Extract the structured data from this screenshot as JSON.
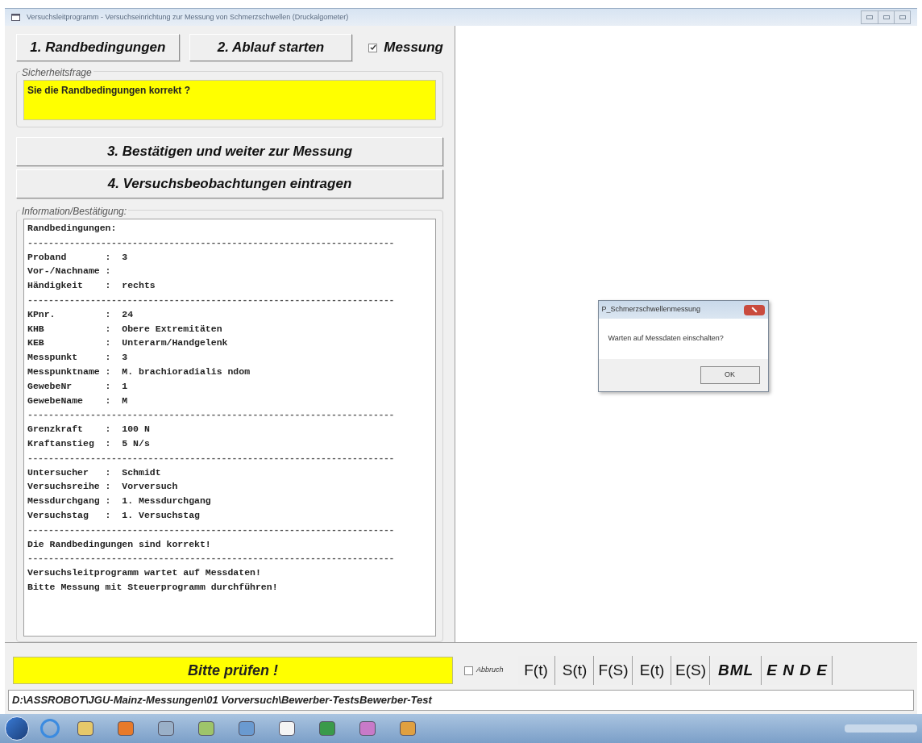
{
  "window": {
    "title": "Versuchsleitprogramm - Versuchseinrichtung zur Messung von Schmerzschwellen (Druckalgometer)"
  },
  "top_buttons": [
    "1. Randbedingungen",
    "2. Ablauf  starten"
  ],
  "measure_checkbox": {
    "label": "Messung",
    "checked": true
  },
  "safety_group": {
    "title": "Sicherheitsfrage",
    "text": "Sie die Randbedingungen korrekt ?"
  },
  "action_buttons": [
    "3. Bestätigen und weiter zur Messung",
    "4. Versuchsbeobachtungen eintragen"
  ],
  "info_group": {
    "title": "Information/Bestätigung:",
    "lines": [
      {
        "kind": "text",
        "text": "Randbedingungen:"
      },
      {
        "kind": "rule",
        "text": "----------------------------------------------------------------------"
      },
      {
        "kind": "text",
        "text": "Proband       :  3"
      },
      {
        "kind": "text",
        "text": "Vor-/Nachname :"
      },
      {
        "kind": "text",
        "text": "Händigkeit    :  rechts"
      },
      {
        "kind": "rule",
        "text": "----------------------------------------------------------------------"
      },
      {
        "kind": "text",
        "text": "KPnr.         :  24"
      },
      {
        "kind": "text",
        "text": "KHB           :  Obere Extremitäten"
      },
      {
        "kind": "text",
        "text": "KEB           :  Unterarm/Handgelenk"
      },
      {
        "kind": "text",
        "text": "Messpunkt     :  3"
      },
      {
        "kind": "text",
        "text": "Messpunktname :  M. brachioradialis ndom"
      },
      {
        "kind": "text",
        "text": "GewebeNr      :  1"
      },
      {
        "kind": "text",
        "text": "GewebeName    :  M"
      },
      {
        "kind": "rule",
        "text": "----------------------------------------------------------------------"
      },
      {
        "kind": "text",
        "text": "Grenzkraft    :  100 N"
      },
      {
        "kind": "text",
        "text": "Kraftanstieg  :  5 N/s"
      },
      {
        "kind": "rule",
        "text": "----------------------------------------------------------------------"
      },
      {
        "kind": "text",
        "text": "Untersucher   :  Schmidt"
      },
      {
        "kind": "text",
        "text": "Versuchsreihe :  Vorversuch"
      },
      {
        "kind": "text",
        "text": "Messdurchgang :  1. Messdurchgang"
      },
      {
        "kind": "text",
        "text": "Versuchstag   :  1. Versuchstag"
      },
      {
        "kind": "rule",
        "text": "----------------------------------------------------------------------"
      },
      {
        "kind": "text",
        "text": "Die Randbedingungen sind korrekt!"
      },
      {
        "kind": "rule",
        "text": "----------------------------------------------------------------------"
      },
      {
        "kind": "text",
        "text": "Versuchsleitprogramm wartet auf Messdaten!"
      },
      {
        "kind": "text",
        "text": "Bitte Messung mit Steuerprogramm durchführen!"
      }
    ]
  },
  "dialog": {
    "title": "P_Schmerzschwellenmessung",
    "message": "Warten auf Messdaten einschalten?",
    "button": "OK"
  },
  "status_message": "Bitte prüfen !",
  "abort_checkbox": {
    "label": "Abbruch",
    "checked": false
  },
  "chart_buttons": [
    {
      "kind": "plain",
      "label": "F(t)"
    },
    {
      "kind": "plain",
      "label": "S(t)"
    },
    {
      "kind": "plain",
      "label": "F(S)"
    },
    {
      "kind": "plain",
      "label": "E(t)"
    },
    {
      "kind": "plain",
      "label": "E(S)"
    },
    {
      "kind": "bold",
      "label": "BML"
    },
    {
      "kind": "bold",
      "label": "E N D E"
    }
  ],
  "path": "D:\\ASSROBOT\\JGU-Mainz-Messungen\\01 Vorversuch\\Bewerber-TestsBewerber-Test"
}
